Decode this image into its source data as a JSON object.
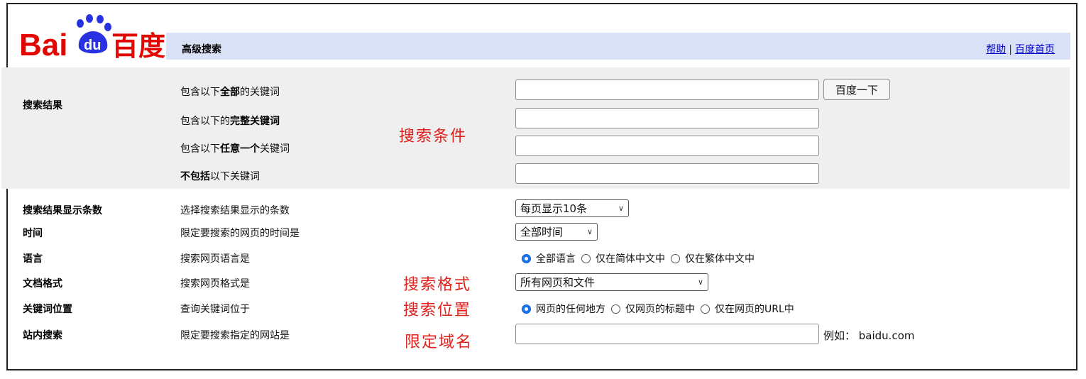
{
  "header": {
    "logo_text_left": "Bai",
    "logo_paw_text": "du",
    "logo_text_right": "百度",
    "page_title": "高级搜索",
    "links": [
      "帮助",
      "百度首页"
    ],
    "link_separator": "|"
  },
  "search_results": {
    "section_label": "搜索结果",
    "rows": [
      {
        "pre": "包含以下",
        "bold": "全部",
        "post": "的关键词"
      },
      {
        "pre": "包含以下的",
        "bold": "完整关键词",
        "post": ""
      },
      {
        "pre": "包含以下",
        "bold": "任意一个",
        "post": "关键词"
      },
      {
        "pre": "",
        "bold": "不包括",
        "post": "以下关键词"
      }
    ],
    "submit_label": "百度一下",
    "annotation": "搜索条件"
  },
  "options": {
    "rows": [
      {
        "label": "搜索结果显示条数",
        "desc": "选择搜索结果显示的条数"
      },
      {
        "label": "时间",
        "desc": "限定要搜索的网页的时间是"
      },
      {
        "label": "语言",
        "desc": "搜索网页语言是"
      },
      {
        "label": "文档格式",
        "desc": "搜索网页格式是"
      },
      {
        "label": "关键词位置",
        "desc": "查询关键词位于"
      },
      {
        "label": "站内搜索",
        "desc": "限定要搜索指定的网站是"
      }
    ],
    "results_per_page": "每页显示10条",
    "time_range": "全部时间",
    "language_options": [
      "全部语言",
      "仅在简体中文中",
      "仅在繁体中文中"
    ],
    "language_selected": 0,
    "format": "所有网页和文件",
    "position_options": [
      "网页的任何地方",
      "仅网页的标题中",
      "仅在网页的URL中"
    ],
    "position_selected": 0,
    "site_example": "例如： baidu.com"
  },
  "annotations": {
    "format": "搜索格式",
    "position": "搜索位置",
    "domain": "限定域名"
  },
  "colors": {
    "logo_red": "#e10602",
    "logo_blue": "#2932e1",
    "header_bar": "#d9e1f7",
    "annotation_red": "#e0201b",
    "link_blue": "#0000cc"
  }
}
